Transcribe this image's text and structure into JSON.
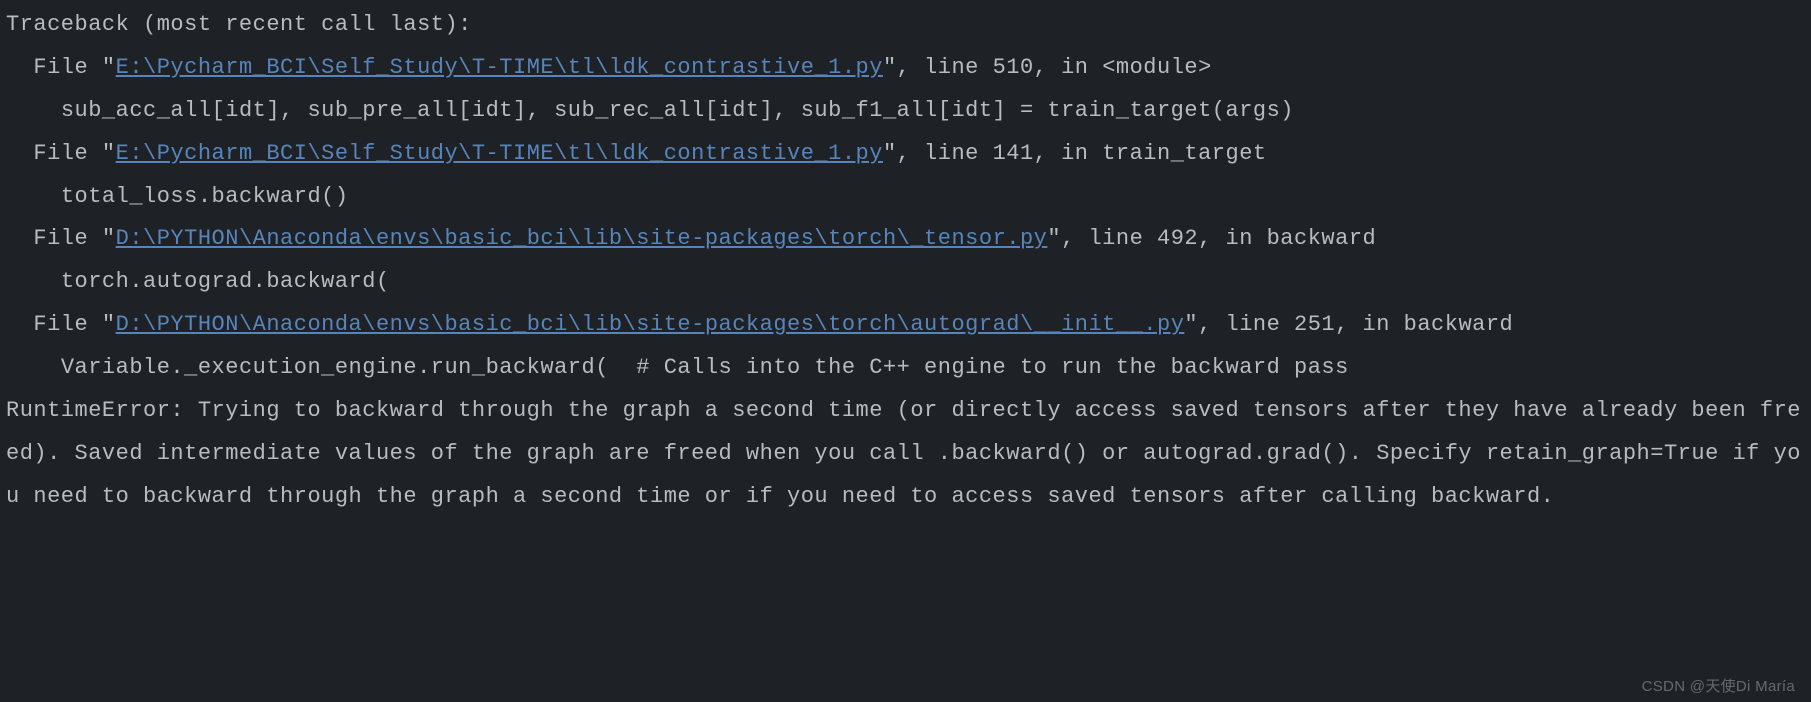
{
  "traceback": {
    "header": "Traceback (most recent call last):",
    "frames": [
      {
        "file_prefix": "  File \"",
        "file_path": "E:\\Pycharm_BCI\\Self_Study\\T-TIME\\tl\\ldk_contrastive_1.py",
        "file_suffix": "\", line 510, in <module>",
        "code": "    sub_acc_all[idt], sub_pre_all[idt], sub_rec_all[idt], sub_f1_all[idt] = train_target(args)"
      },
      {
        "file_prefix": "  File \"",
        "file_path": "E:\\Pycharm_BCI\\Self_Study\\T-TIME\\tl\\ldk_contrastive_1.py",
        "file_suffix": "\", line 141, in train_target",
        "code": "    total_loss.backward()"
      },
      {
        "file_prefix": "  File \"",
        "file_path": "D:\\PYTHON\\Anaconda\\envs\\basic_bci\\lib\\site-packages\\torch\\_tensor.py",
        "file_suffix": "\", line 492, in backward",
        "code": "    torch.autograd.backward("
      },
      {
        "file_prefix": "  File \"",
        "file_path": "D:\\PYTHON\\Anaconda\\envs\\basic_bci\\lib\\site-packages\\torch\\autograd\\__init__.py",
        "file_suffix": "\", line 251, in backward",
        "code": "    Variable._execution_engine.run_backward(  # Calls into the C++ engine to run the backward pass"
      }
    ],
    "error": "RuntimeError: Trying to backward through the graph a second time (or directly access saved tensors after they have already been freed). Saved intermediate values of the graph are freed when you call .backward() or autograd.grad(). Specify retain_graph=True if you need to backward through the graph a second time or if you need to access saved tensors after calling backward."
  },
  "watermark": "CSDN @天使Di María"
}
